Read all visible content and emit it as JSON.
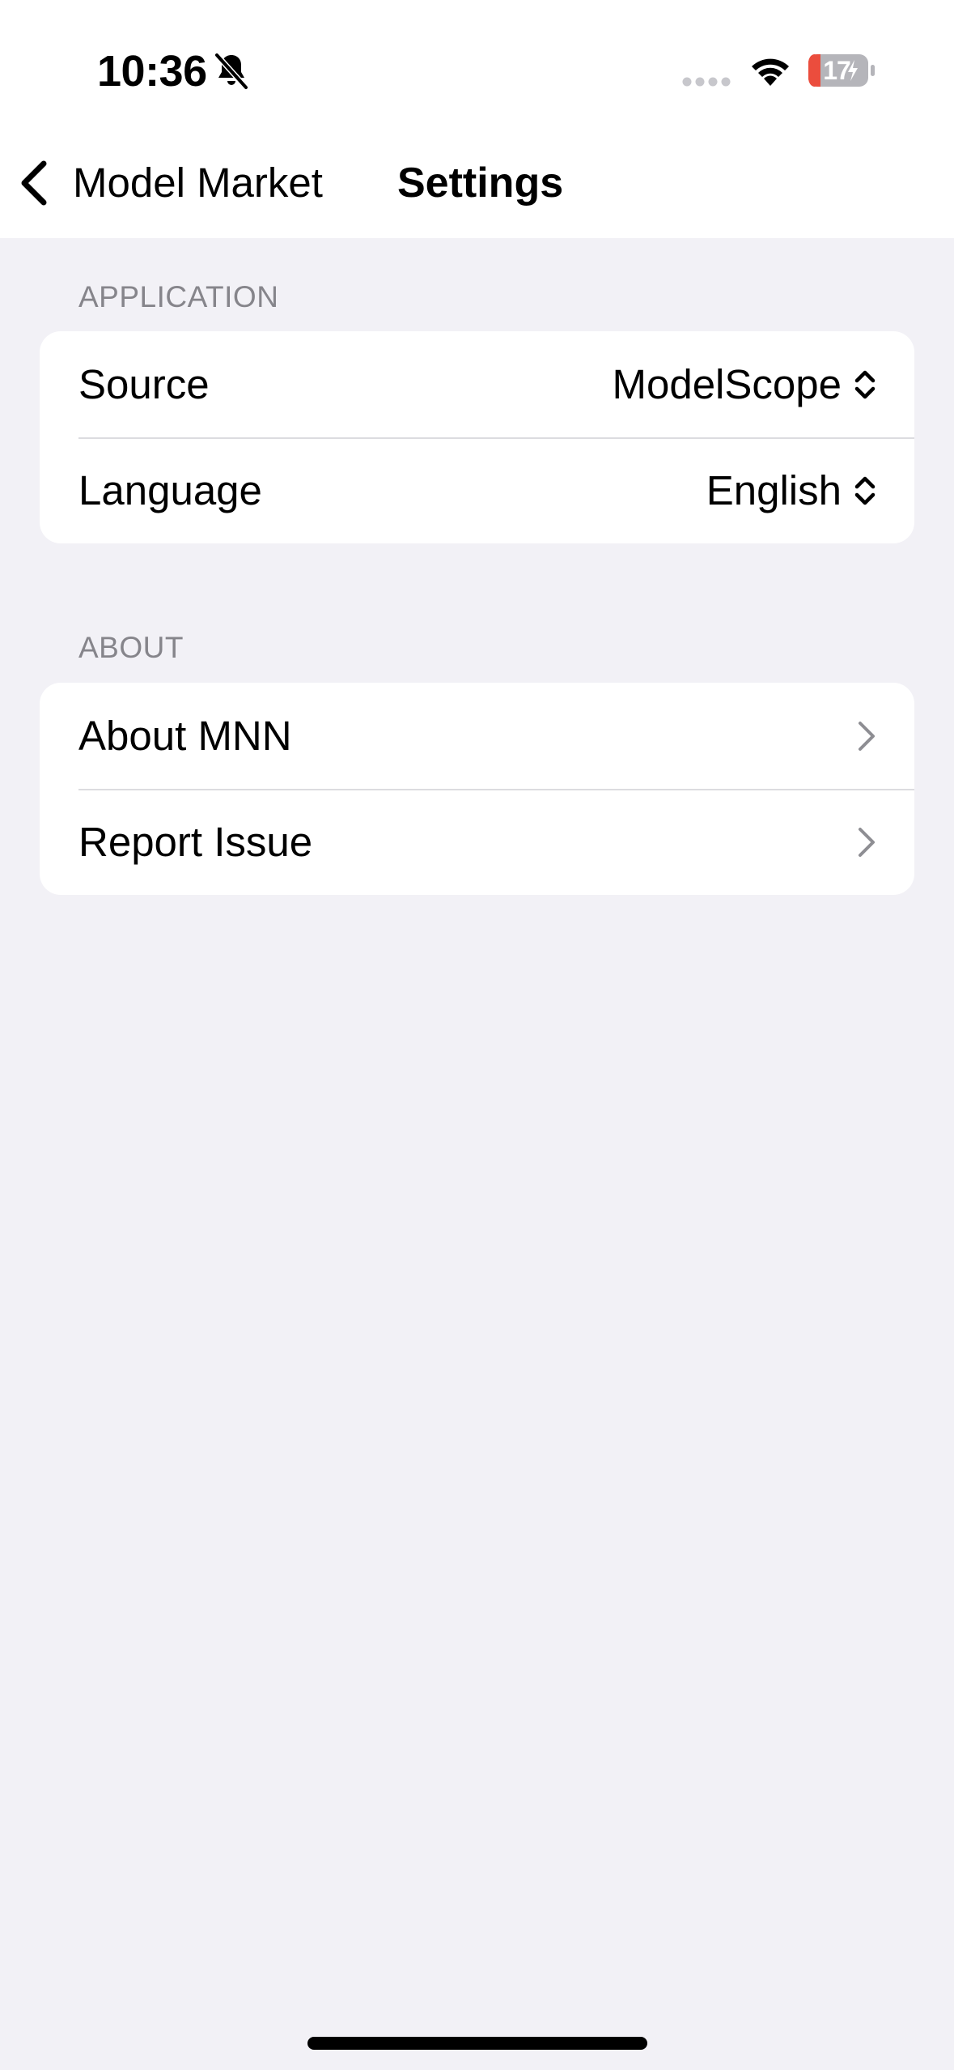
{
  "status_bar": {
    "time": "10:36",
    "battery_level": "17",
    "icons": [
      "bell-slash-icon",
      "cellular-signal-icon",
      "wifi-icon",
      "battery-charging-icon"
    ],
    "battery_low_color": "#eb4d3d"
  },
  "nav": {
    "back_label": "Model Market",
    "title": "Settings"
  },
  "sections": {
    "application": {
      "header": "APPLICATION",
      "rows": [
        {
          "label": "Source",
          "value": "ModelScope"
        },
        {
          "label": "Language",
          "value": "English"
        }
      ]
    },
    "about": {
      "header": "ABOUT",
      "rows": [
        {
          "label": "About MNN"
        },
        {
          "label": "Report Issue"
        }
      ]
    }
  },
  "colors": {
    "background": "#f2f1f6",
    "card": "#ffffff",
    "secondary_text": "#86858b",
    "chevron": "#8e8e93"
  }
}
